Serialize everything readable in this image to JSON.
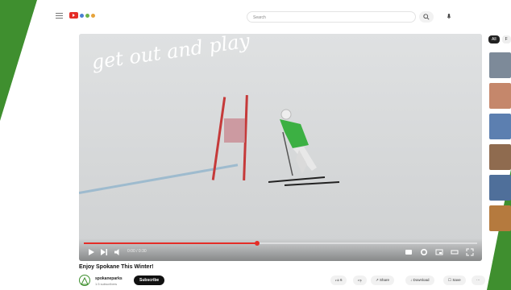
{
  "header": {
    "search_placeholder": "Search",
    "icons": [
      "menu-icon",
      "youtube-logo",
      "search-icon",
      "mic-icon"
    ]
  },
  "video": {
    "overlay_text": "get out and play",
    "progress_fraction": 0.44,
    "time_label": "0:00 / 0:30"
  },
  "sidebar": {
    "chips": [
      "All",
      "F"
    ]
  },
  "below": {
    "title": "Enjoy Spokane This Winter!",
    "channel_name": "spokaneparks",
    "subscribers": "1.5 subscribers",
    "subscribe_label": "Subscribe",
    "like_count": "6",
    "share_label": "Share",
    "download_label": "Download",
    "save_label": "Save",
    "more_label": "···"
  },
  "colors": {
    "accent": "#e52d27",
    "brand_green": "#3f8f2f"
  }
}
